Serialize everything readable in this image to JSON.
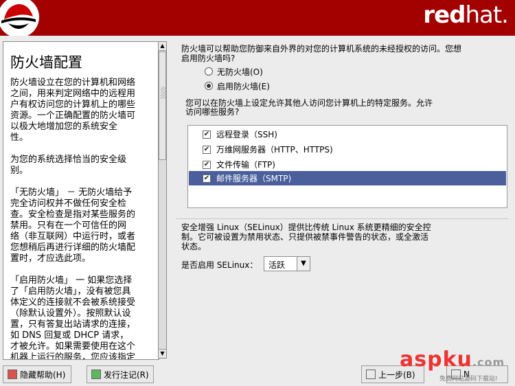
{
  "header": {
    "brand_bold": "red",
    "brand_thin": "hat."
  },
  "help": {
    "title": "防火墙配置",
    "paragraphs": [
      "防火墙设立在您的计算机和网络\n之间，用来判定网络中的远程用\n户有权访问您的计算机上的哪些\n资源。一个正确配置的防火墙可\n以极大地增加您的系统安全\n性。",
      "为您的系统选择恰当的安全级\n别。",
      "「无防火墙」 － 无防火墙给予\n完全访问权并不做任何安全检\n查。安全检查是指对某些服务的\n禁用。只有在一个可信任的网\n络（非互联网）中运行时，或者\n您想稍后再进行详细的防火墙配\n置时，才应选此项。",
      "「启用防火墙」 一 如果您选择\n了「启用防火墙」，没有被您具\n体定义的连接就不会被系统接受\n（除默认设置外）。按照默认设\n置，只有答复出站请求的连接，\n如 DNS 回复或 DHCP 请求，\n才被允许。如果需要使用在这个\n机器上运行的服务，您应该指定"
    ]
  },
  "main": {
    "intro": "防火墙可以帮助您防御来自外界的对您的计算机系统的未经授权的访问。您想\n启用防火墙吗?",
    "radio_none": "无防火墙(O)",
    "radio_enable": "启用防火墙(E)",
    "services_intro": "您可以在防火墙上设定允许其他人访问您计算机上的特定服务。允许\n访问哪些服务?",
    "services": [
      {
        "label": "远程登录（SSH)",
        "checked": true
      },
      {
        "label": "万维网服务器（HTTP、HTTPS)",
        "checked": true
      },
      {
        "label": "文件传输（FTP)",
        "checked": true
      },
      {
        "label": "邮件服务器（SMTP)",
        "checked": true
      }
    ],
    "selinux_text": "安全增强 Linux（SELinux）提供比传统 Linux 系统更精细的安全控\n制。它可被设置为禁用状态、只提供被禁事件警告的状态，或全激活\n状态。",
    "selinux_label": "是否启用 SELinux：",
    "selinux_value": "活跃"
  },
  "buttons": {
    "hide_help": "隐藏帮助(H)",
    "release_notes": "发行注记(R)",
    "back": "上一步(B)",
    "next": "N"
  },
  "watermark": {
    "main": "aspku",
    "dot": ".com",
    "sub": "免费网站源码下载站!"
  }
}
